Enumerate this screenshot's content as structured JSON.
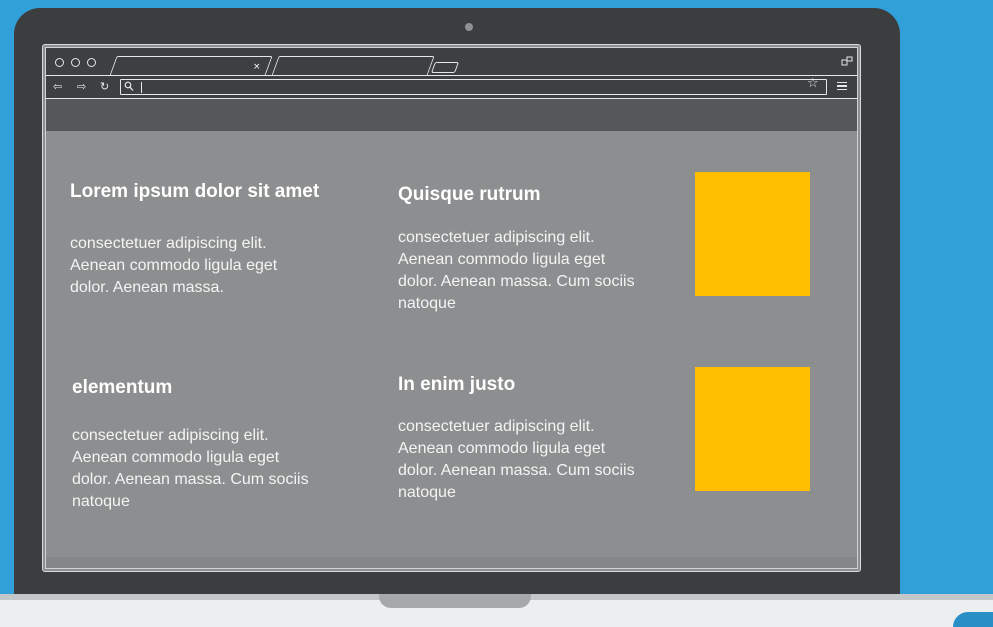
{
  "browser": {
    "tab_close_glyph": "×",
    "nav_back_glyph": "⇦",
    "nav_forward_glyph": "⇨",
    "nav_reload_glyph": "↻",
    "bookmark_glyph": "☆",
    "address_value": ""
  },
  "content": {
    "cards": [
      {
        "heading": "Lorem ipsum dolor sit amet",
        "body": "consectetuer adipiscing elit. Aenean commodo ligula eget dolor. Aenean massa."
      },
      {
        "heading": "Quisque rutrum",
        "body": "consectetuer adipiscing elit. Aenean commodo ligula eget dolor. Aenean massa. Cum sociis natoque"
      },
      {
        "heading": "elementum",
        "body": "consectetuer adipiscing elit. Aenean commodo ligula eget dolor. Aenean massa. Cum sociis natoque"
      },
      {
        "heading": "In enim justo",
        "body": "consectetuer adipiscing elit. Aenean commodo ligula eget dolor. Aenean massa. Cum sociis natoque"
      }
    ],
    "placeholder_color": "#ffbf00"
  },
  "colors": {
    "background": "#32a0d8",
    "laptop_frame": "#3b3d3e",
    "page": "#8c8e8f"
  }
}
